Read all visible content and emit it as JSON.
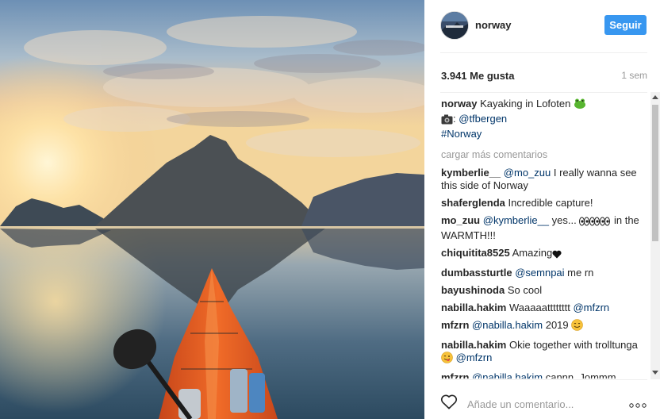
{
  "post": {
    "username": "norway",
    "follow_label": "Seguir",
    "likes": "3.941 Me gusta",
    "age": "1 sem",
    "caption": {
      "user": "norway",
      "text": "Kayaking in Lofoten",
      "camera_prefix": ":",
      "credit": "@tfbergen",
      "hashtag": "#Norway"
    },
    "load_more": "cargar más comentarios",
    "comments": [
      {
        "user": "kymberlie__",
        "mention": "@mo_zuu",
        "text": "I really wanna see this side of Norway"
      },
      {
        "user": "shaferglenda",
        "text": "Incredible capture!"
      },
      {
        "user": "mo_zuu",
        "mention": "@kymberlie__",
        "text": "yes...",
        "text_after": "in the WARMTH!!!"
      },
      {
        "user": "chiquitita8525",
        "text": "Amazing"
      },
      {
        "user": "dumbassturtle",
        "mention": "@semnpai",
        "text": "me rn"
      },
      {
        "user": "bayushinoda",
        "text": "So cool"
      },
      {
        "user": "nabilla.hakim",
        "text": "Waaaaatttttttt",
        "mention_after": "@mfzrn"
      },
      {
        "user": "mfzrn",
        "mention": "@nabilla.hakim",
        "text": "2019"
      },
      {
        "user": "nabilla.hakim",
        "text": "Okie together with trolltunga",
        "mention_after": "@mfzrn"
      },
      {
        "user": "mfzrn",
        "mention": "@nabilla.hakim",
        "text": "cannn. Jommm"
      }
    ],
    "comment_placeholder": "Añade un comentario..."
  },
  "icons": {
    "like": "heart-outline-icon",
    "more": "more-options-icon",
    "camera": "camera-emoji",
    "frog": "frog-emoji",
    "eyes": "eyes-emoji",
    "black_heart": "black-heart-emoji",
    "smile": "smiling-face-emoji",
    "heart_eyes": "heart-eyes-emoji",
    "tongue": "face-savoring-emoji"
  },
  "colors": {
    "follow_button": "#3897f0",
    "mention": "#003569",
    "kayak": "#e85a1c"
  }
}
